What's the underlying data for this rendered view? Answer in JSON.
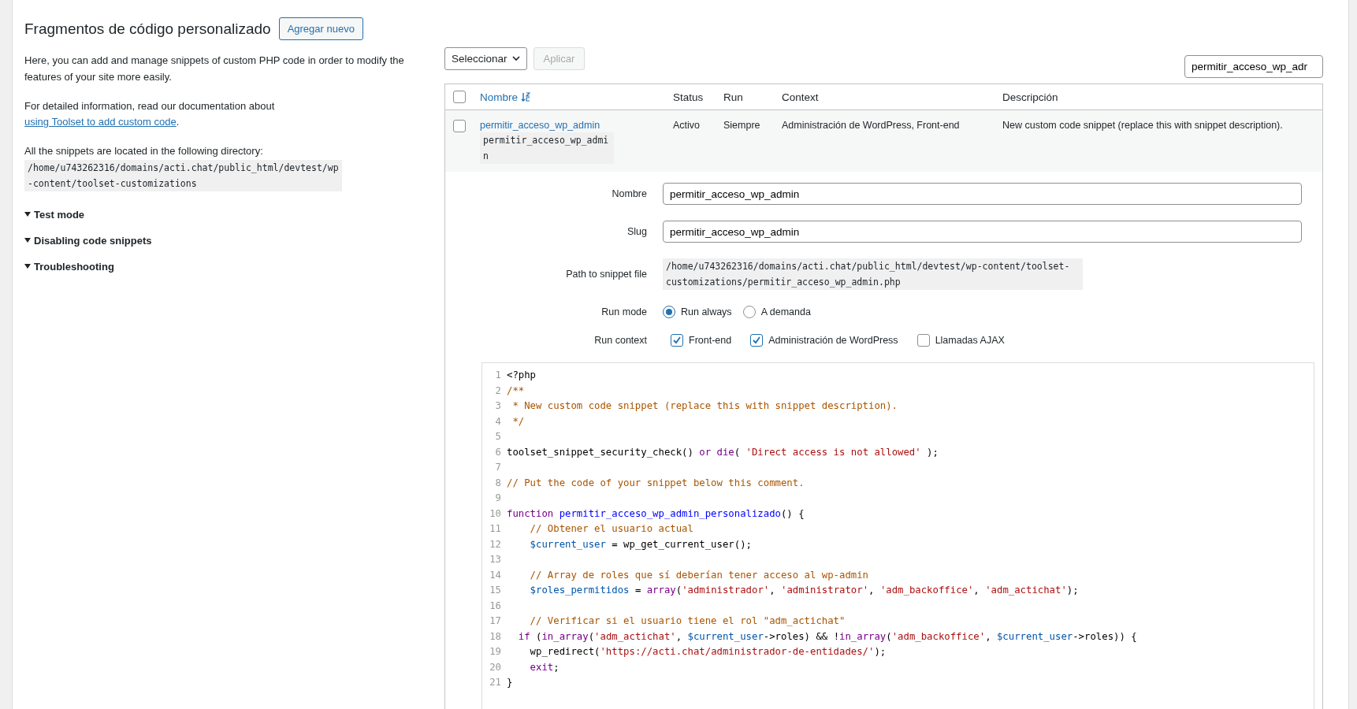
{
  "page": {
    "title": "Fragmentos de código personalizado",
    "add_button": "Agregar nuevo"
  },
  "info": {
    "intro": "Here, you can add and manage snippets of custom PHP code in order to modify the features of your site more easily.",
    "doc_text": "For detailed information, read our documentation about",
    "doc_link": "using Toolset to add custom code",
    "doc_end": ".",
    "dir_text": "All the snippets are located in the following directory:",
    "dir_path": "/home/u743262316/domains/acti.chat/public_html/devtest/wp-content/toolset-customizations"
  },
  "sections": [
    {
      "label": "Test mode",
      "expanded": true
    },
    {
      "label": "Disabling code snippets",
      "expanded": true
    },
    {
      "label": "Troubleshooting",
      "expanded": true
    }
  ],
  "bulk": {
    "select": "Seleccionar",
    "apply": "Aplicar",
    "apply_disabled": true
  },
  "search": {
    "value": "permitir_acceso_wp_adr"
  },
  "table": {
    "select_all_checked": false,
    "columns": [
      "Nombre",
      "Status",
      "Run",
      "Context",
      "Descripción"
    ],
    "rows": [
      {
        "checked": false,
        "name": "permitir_acceso_wp_admin",
        "slug": "permitir_acceso_wp_admin",
        "status": "Activo",
        "run": "Siempre",
        "context": "Administración de WordPress, Front-end",
        "description": "New custom code snippet (replace this with snippet description)."
      }
    ]
  },
  "details": {
    "name_label": "Nombre",
    "name_value": "permitir_acceso_wp_admin",
    "slug_label": "Slug",
    "slug_value": "permitir_acceso_wp_admin",
    "path_label": "Path to snippet file",
    "path_value": "/home/u743262316/domains/acti.chat/public_html/devtest/wp-content/toolset-customizations/permitir_acceso_wp_admin.php",
    "run_mode_label": "Run mode",
    "run_modes": [
      {
        "label": "Run always",
        "selected": true
      },
      {
        "label": "A demanda",
        "selected": false
      }
    ],
    "run_context_label": "Run context",
    "run_contexts": [
      {
        "label": "Front-end",
        "checked": true
      },
      {
        "label": "Administración de WordPress",
        "checked": true
      },
      {
        "label": "Llamadas AJAX",
        "checked": false
      }
    ]
  },
  "editor": {
    "lines": [
      {
        "number": "1",
        "tokens": [
          {
            "kind": "plain",
            "text": "<?php"
          }
        ]
      },
      {
        "number": "2",
        "tokens": [
          {
            "kind": "comment",
            "text": "/**"
          }
        ]
      },
      {
        "number": "3",
        "tokens": [
          {
            "kind": "comment",
            "text": " * New custom code snippet (replace this with snippet description)."
          }
        ]
      },
      {
        "number": "4",
        "tokens": [
          {
            "kind": "comment",
            "text": " */"
          }
        ]
      },
      {
        "number": "5"
      },
      {
        "number": "6",
        "tokens": [
          {
            "kind": "plain",
            "text": "toolset_snippet_security_check() "
          },
          {
            "kind": "keyword",
            "text": "or"
          },
          {
            "kind": "keyword",
            "text": " die"
          },
          {
            "kind": "plain",
            "text": "( "
          },
          {
            "kind": "string",
            "text": "'Direct access is not allowed'"
          },
          {
            "kind": "plain",
            "text": " );"
          }
        ]
      },
      {
        "number": "7"
      },
      {
        "number": "8",
        "tokens": [
          {
            "kind": "comment",
            "text": "// Put the code of your snippet below this comment."
          }
        ]
      },
      {
        "number": "9"
      },
      {
        "number": "10",
        "tokens": [
          {
            "kind": "keyword",
            "text": "function"
          },
          {
            "kind": "def",
            "text": " permitir_acceso_wp_admin_personalizado"
          },
          {
            "kind": "plain",
            "text": "() {"
          }
        ]
      },
      {
        "number": "11",
        "tokens": [
          {
            "kind": "comment",
            "text": "    // Obtener el usuario actual"
          }
        ]
      },
      {
        "number": "12",
        "tokens": [
          {
            "kind": "variable",
            "text": "    $current_user"
          },
          {
            "kind": "plain",
            "text": " = wp_get_current_user();"
          }
        ]
      },
      {
        "number": "13"
      },
      {
        "number": "14",
        "tokens": [
          {
            "kind": "comment",
            "text": "    // Array de roles que sí deberían tener acceso al wp-admin"
          }
        ]
      },
      {
        "number": "15",
        "tokens": [
          {
            "kind": "variable",
            "text": "    $roles_permitidos"
          },
          {
            "kind": "plain",
            "text": " = "
          },
          {
            "kind": "keyword",
            "text": "array"
          },
          {
            "kind": "plain",
            "text": "("
          },
          {
            "kind": "string",
            "text": "'administrador'"
          },
          {
            "kind": "plain",
            "text": ", "
          },
          {
            "kind": "string",
            "text": "'administrator'"
          },
          {
            "kind": "plain",
            "text": ", "
          },
          {
            "kind": "string",
            "text": "'adm_backoffice'"
          },
          {
            "kind": "plain",
            "text": ", "
          },
          {
            "kind": "string",
            "text": "'adm_actichat'"
          },
          {
            "kind": "plain",
            "text": ");"
          }
        ]
      },
      {
        "number": "16"
      },
      {
        "number": "17",
        "tokens": [
          {
            "kind": "comment",
            "text": "    // Verificar si el usuario tiene el rol \"adm_actichat\""
          }
        ]
      },
      {
        "number": "18",
        "tokens": [
          {
            "kind": "keyword",
            "text": "  if"
          },
          {
            "kind": "plain",
            "text": " ("
          },
          {
            "kind": "keyword",
            "text": "in_array"
          },
          {
            "kind": "plain",
            "text": "("
          },
          {
            "kind": "string",
            "text": "'adm_actichat'"
          },
          {
            "kind": "plain",
            "text": ", "
          },
          {
            "kind": "variable",
            "text": "$current_user"
          },
          {
            "kind": "plain",
            "text": "->roles) && !"
          },
          {
            "kind": "keyword",
            "text": "in_array"
          },
          {
            "kind": "plain",
            "text": "("
          },
          {
            "kind": "string",
            "text": "'adm_backoffice'"
          },
          {
            "kind": "plain",
            "text": ", "
          },
          {
            "kind": "variable",
            "text": "$current_user"
          },
          {
            "kind": "plain",
            "text": "->roles)) {"
          }
        ]
      },
      {
        "number": "19",
        "tokens": [
          {
            "kind": "plain",
            "text": "    wp_redirect("
          },
          {
            "kind": "string",
            "text": "'https://acti.chat/administrador-de-entidades/'"
          },
          {
            "kind": "plain",
            "text": ");"
          }
        ]
      },
      {
        "number": "20",
        "tokens": [
          {
            "kind": "keyword",
            "text": "    exit"
          },
          {
            "kind": "plain",
            "text": ";"
          }
        ]
      },
      {
        "number": "21",
        "tokens": [
          {
            "kind": "plain",
            "text": "}"
          }
        ]
      }
    ]
  }
}
